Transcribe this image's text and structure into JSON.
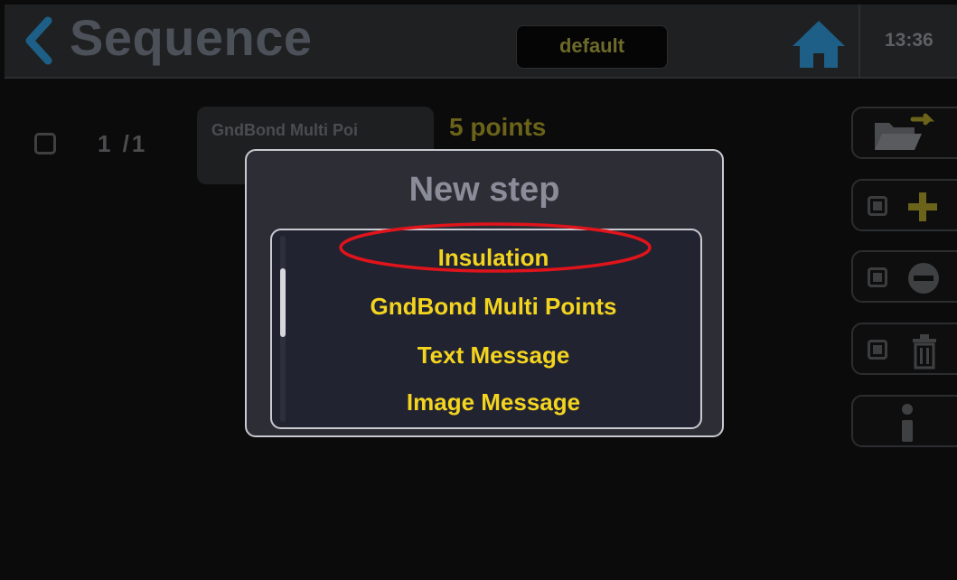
{
  "header": {
    "title": "Sequence",
    "profile": "default",
    "clock": "13:36"
  },
  "sequence": {
    "row_index": "1 /1",
    "step_name": "GndBond Multi Poi",
    "step_points": "5 points"
  },
  "modal": {
    "title": "New step",
    "items": [
      {
        "label": "Insulation"
      },
      {
        "label": "GndBond Multi Points"
      },
      {
        "label": "Text Message"
      },
      {
        "label": "Image Message"
      }
    ],
    "highlighted_item": "Insulation"
  },
  "colors": {
    "accent_yellow": "#f3d41f",
    "annotation_red": "#e0141b",
    "modal_bg": "#2d2e35",
    "page_bg": "#0b0b0c"
  },
  "icons": [
    "back-chevron-icon",
    "home-icon",
    "folder-export-icon",
    "plus-icon",
    "minus-circle-icon",
    "trash-icon",
    "info-icon"
  ]
}
